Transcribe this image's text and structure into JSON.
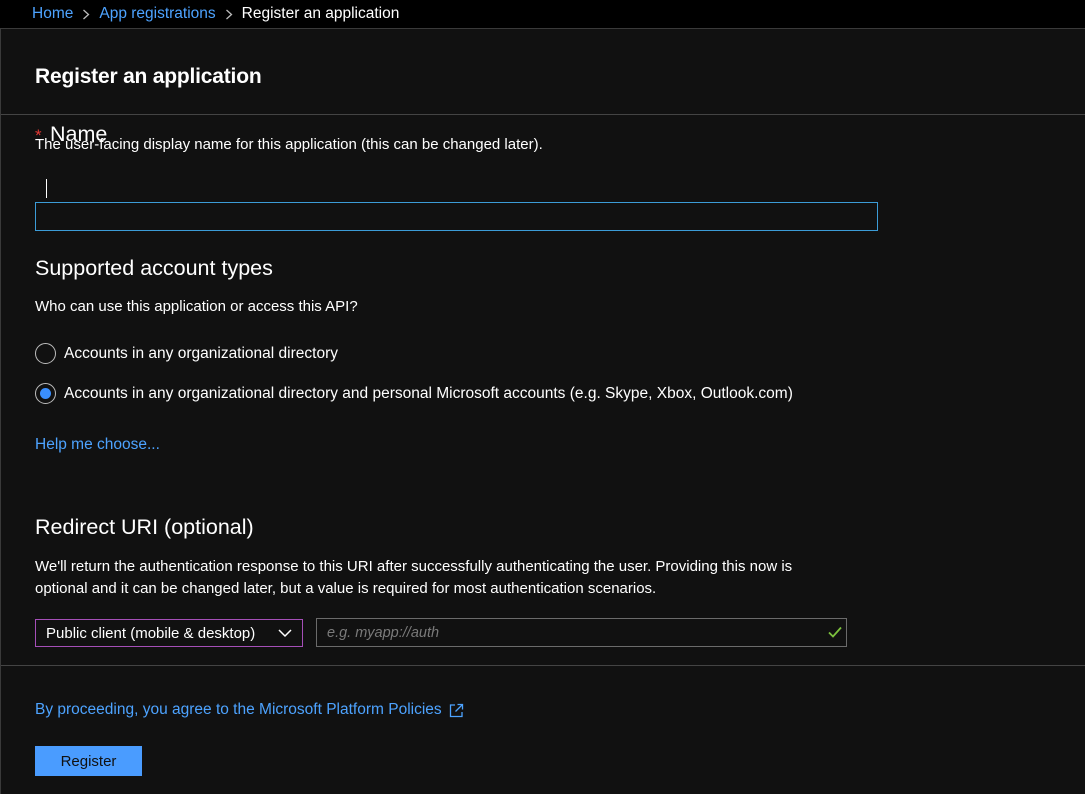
{
  "breadcrumb": {
    "home": "Home",
    "app_registrations": "App registrations",
    "current": "Register an application"
  },
  "blade": {
    "title": "Register an application"
  },
  "name_section": {
    "required_marker": "*",
    "title": "Name",
    "description": "The user-facing display name for this application (this can be changed later).",
    "input_value": ""
  },
  "account_types": {
    "title": "Supported account types",
    "question": "Who can use this application or access this API?",
    "options": [
      {
        "label": "Accounts in any organizational directory",
        "selected": false
      },
      {
        "label": "Accounts in any organizational directory and personal Microsoft accounts (e.g. Skype, Xbox, Outlook.com)",
        "selected": true
      }
    ],
    "help_link": "Help me choose..."
  },
  "redirect_uri": {
    "title": "Redirect URI (optional)",
    "description_line1": "We'll return the authentication response to this URI after successfully authenticating the user. Providing this now is",
    "description_line2": "optional and it can be changed later, but a value is required for most authentication scenarios.",
    "platform_selected": "Public client (mobile & desktop)",
    "uri_placeholder": "e.g. myapp://auth",
    "uri_value": ""
  },
  "footer": {
    "policy_text": "By proceeding, you agree to the Microsoft Platform Policies",
    "register_label": "Register"
  },
  "colors": {
    "background": "#111111",
    "link": "#4da3ff",
    "accent_button": "#4a9cff",
    "input_focus_border": "#3c9cd7",
    "select_border": "#a54fb8",
    "required": "#e53935",
    "valid_check": "#7cc13d"
  },
  "icons": {
    "breadcrumb_separator": "chevron-right-icon",
    "select_arrow": "chevron-down-icon",
    "uri_valid": "checkmark-icon",
    "policy_external": "external-link-icon"
  }
}
